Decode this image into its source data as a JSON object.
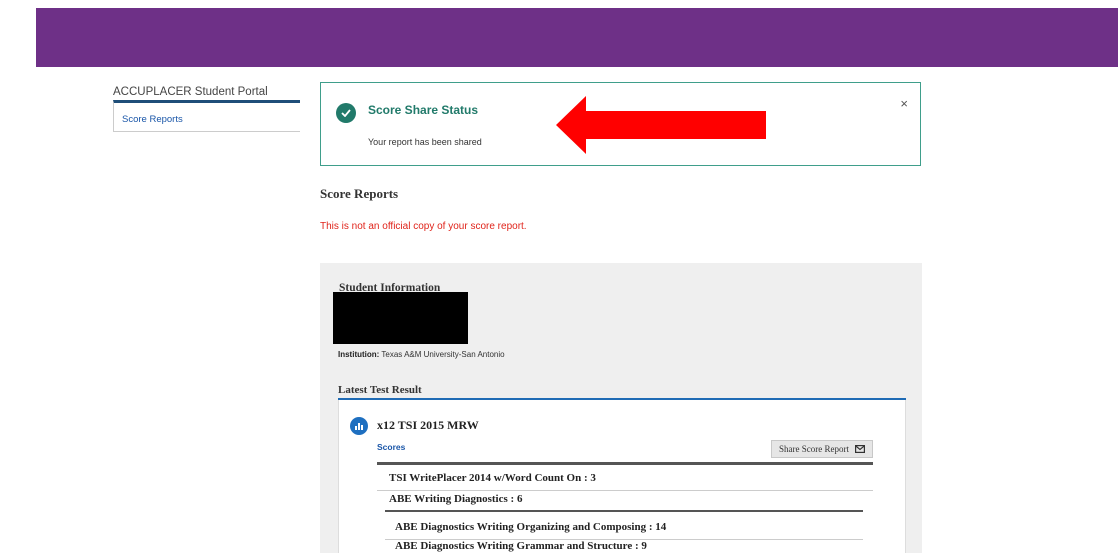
{
  "sidebar": {
    "title": "ACCUPLACER Student Portal",
    "items": [
      {
        "label": "Score Reports"
      }
    ]
  },
  "alert": {
    "title": "Score Share Status",
    "message": "Your report has been shared",
    "close": "×"
  },
  "main": {
    "heading": "Score Reports",
    "warning": "This is not an official copy of your score report."
  },
  "student": {
    "label": "Student Information",
    "institution_label": "Institution:",
    "institution": "Texas A&M University-San Antonio"
  },
  "latest": {
    "title": "Latest Test Result",
    "test_name": "x12 TSI 2015 MRW",
    "scores_tab": "Scores",
    "share_button": "Share Score Report",
    "rows": [
      "TSI WritePlacer 2014 w/Word Count On : 3",
      "ABE Writing Diagnostics : 6"
    ],
    "subrows": [
      "ABE Diagnostics Writing Organizing and Composing : 14",
      "ABE Diagnostics Writing Grammar and Structure : 9"
    ]
  },
  "colors": {
    "header": "#6e3087",
    "success": "#217a6a",
    "warning": "#e0241b",
    "link": "#1a56a8",
    "annotation_arrow": "#ff0000"
  }
}
